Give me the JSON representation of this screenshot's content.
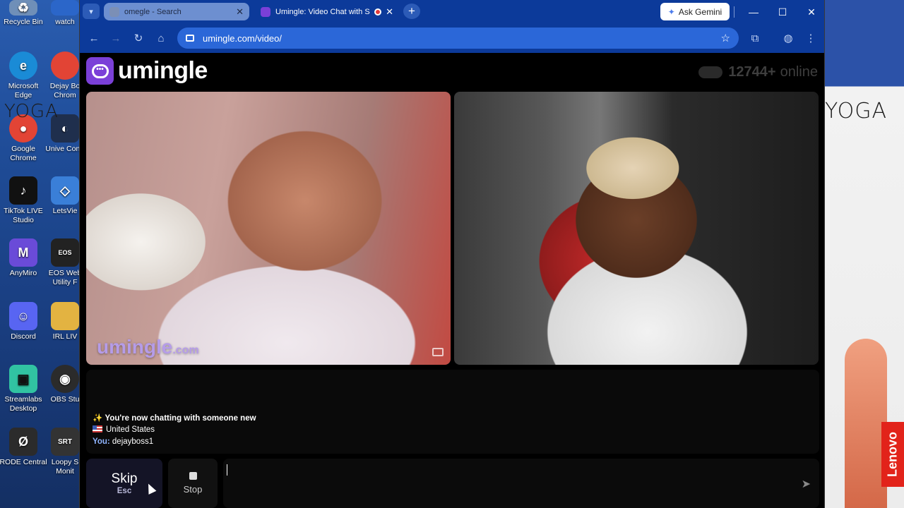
{
  "desktop": {
    "icons": [
      {
        "label": "Recycle Bin",
        "color": "#6f8fb8"
      },
      {
        "label": "watch",
        "color": "#2b66c9"
      },
      {
        "label": "Microsoft Edge",
        "color": "#1a8bd6"
      },
      {
        "label": "Dejay Bo Chrom",
        "color": "#e24435"
      },
      {
        "label": "Google Chrome",
        "color": "#e24435"
      },
      {
        "label": "Unive Contr",
        "color": "#1f2f4d"
      },
      {
        "label": "TikTok LIVE Studio",
        "color": "#111111"
      },
      {
        "label": "LetsVie",
        "color": "#3a7fd8"
      },
      {
        "label": "AnyMiro",
        "color": "#6a4bd8"
      },
      {
        "label": "EOS Web Utility F",
        "color": "#222222"
      },
      {
        "label": "Discord",
        "color": "#5865f2"
      },
      {
        "label": "IRL LIV",
        "color": "#e3b341"
      },
      {
        "label": "Streamlabs Desktop",
        "color": "#31c3a2"
      },
      {
        "label": "OBS Stu",
        "color": "#2b2b2b"
      },
      {
        "label": "RODE Central",
        "color": "#2b2b2b"
      },
      {
        "label": "Loopy S Monit",
        "color": "#333333"
      }
    ],
    "yoga_text": "YOGA",
    "lenovo_text": "Lenovo"
  },
  "browser": {
    "tabs": [
      {
        "title": "omegle - Search",
        "active": false
      },
      {
        "title": "Umingle: Video Chat with S",
        "active": true
      }
    ],
    "ask_gemini": "Ask Gemini",
    "url": "umingle.com/video/"
  },
  "page": {
    "logo_text": "umingle",
    "online_count": "12744+",
    "online_label": "online",
    "watermark": "umingle",
    "watermark_suffix": ".com",
    "chat": {
      "system_message": "You're now chatting with someone new",
      "country": "United States",
      "you_label": "You:",
      "you_message": "dejayboss1"
    },
    "skip_label": "Skip",
    "skip_key": "Esc",
    "stop_label": "Stop"
  },
  "colors": {
    "brand": "#7b40d8",
    "browser_chrome": "#0c3a9a",
    "omnibox": "#2b67d8"
  }
}
